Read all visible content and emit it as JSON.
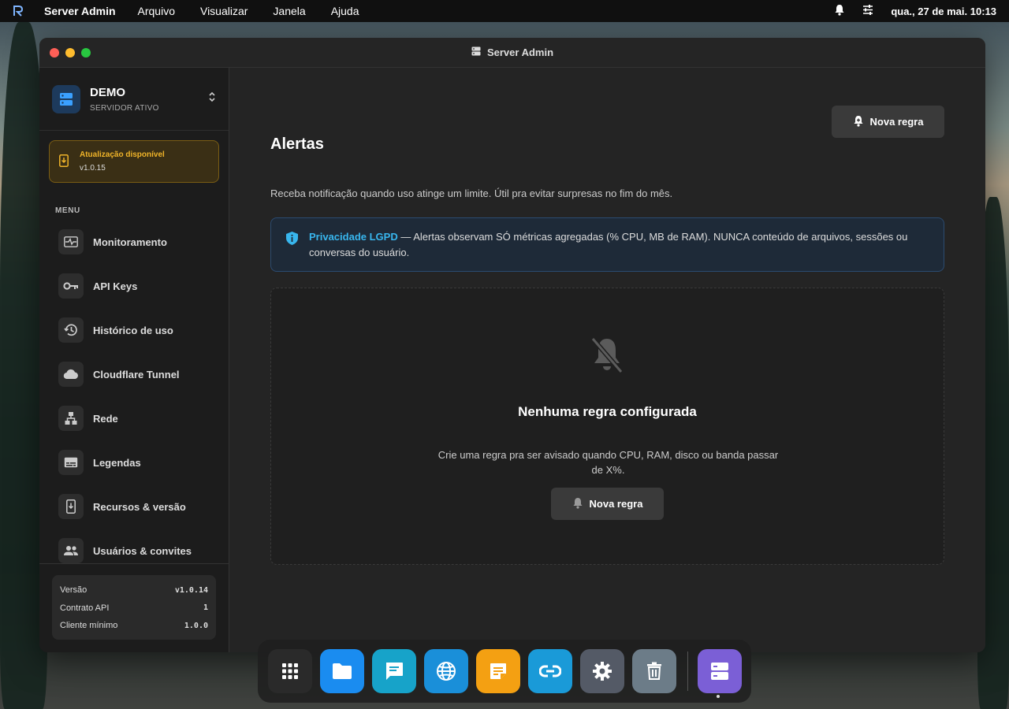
{
  "menubar": {
    "app_name": "Server Admin",
    "menus": [
      "Arquivo",
      "Visualizar",
      "Janela",
      "Ajuda"
    ],
    "clock": "qua., 27 de mai. 10:13"
  },
  "window": {
    "title": "Server Admin"
  },
  "sidebar": {
    "server_name": "DEMO",
    "server_status": "SERVIDOR ATIVO",
    "update_title": "Atualização disponível",
    "update_version": "v1.0.15",
    "menu_heading": "MENU",
    "items": [
      {
        "label": "Monitoramento",
        "icon": "monitor-heartbeat-icon"
      },
      {
        "label": "API Keys",
        "icon": "key-icon"
      },
      {
        "label": "Histórico de uso",
        "icon": "history-icon"
      },
      {
        "label": "Cloudflare Tunnel",
        "icon": "cloud-icon"
      },
      {
        "label": "Rede",
        "icon": "network-icon"
      },
      {
        "label": "Legendas",
        "icon": "subtitles-icon"
      },
      {
        "label": "Recursos & versão",
        "icon": "install-icon"
      },
      {
        "label": "Usuários & convites",
        "icon": "users-icon"
      }
    ],
    "footer": {
      "version_label": "Versão",
      "version_value": "v1.0.14",
      "api_label": "Contrato API",
      "api_value": "1",
      "client_label": "Cliente mínimo",
      "client_value": "1.0.0"
    }
  },
  "main": {
    "new_rule_label": "Nova regra",
    "title": "Alertas",
    "description": "Receba notificação quando uso atinge um limite. Útil pra evitar surpresas no fim do mês.",
    "privacy_title": "Privacidade LGPD",
    "privacy_text": " — Alertas observam SÓ métricas agregadas (% CPU, MB de RAM). NUNCA conteúdo de arquivos, sessões ou conversas do usuário.",
    "empty_title": "Nenhuma regra configurada",
    "empty_desc": "Crie uma regra pra ser avisado quando CPU, RAM, disco ou banda passar de X%.",
    "empty_button": "Nova regra"
  },
  "dock": {
    "apps": [
      {
        "icon": "apps-grid-icon",
        "color": "#2a2a2a"
      },
      {
        "icon": "folder-icon",
        "color": "#1a8cf0"
      },
      {
        "icon": "chat-icon",
        "color": "#17a3c9"
      },
      {
        "icon": "globe-icon",
        "color": "#1a8fd9"
      },
      {
        "icon": "notes-icon",
        "color": "#f4a012"
      },
      {
        "icon": "link-icon",
        "color": "#1a9ad8"
      },
      {
        "icon": "settings-icon",
        "color": "#545a66"
      },
      {
        "icon": "trash-icon",
        "color": "#6c7c88"
      },
      {
        "icon": "server-admin-icon",
        "color": "#7b5fd6"
      }
    ]
  },
  "colors": {
    "accent_blue": "#38b6ee",
    "update_amber": "#f0b429"
  }
}
